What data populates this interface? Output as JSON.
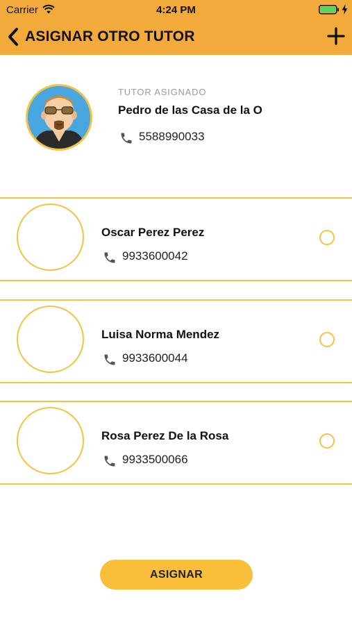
{
  "status_bar": {
    "carrier": "Carrier",
    "time": "4:24 PM",
    "battery_icon": "battery-charging-icon"
  },
  "nav": {
    "back_icon": "chevron-left-icon",
    "title": "ASIGNAR OTRO TUTOR",
    "add_icon": "plus-icon"
  },
  "assigned_tutor": {
    "label": "TUTOR ASIGNADO",
    "name": "Pedro de las Casa de la O",
    "phone": "5588990033"
  },
  "tutors": [
    {
      "name": "Oscar Perez Perez",
      "phone": "9933600042",
      "selected": false
    },
    {
      "name": "Luisa Norma Mendez",
      "phone": "9933600044",
      "selected": false
    },
    {
      "name": "Rosa Perez De la Rosa",
      "phone": "9933500066",
      "selected": false
    }
  ],
  "assign_button": {
    "label": "ASIGNAR"
  },
  "colors": {
    "header": "#f2aa3a",
    "accent_border": "#f5c242",
    "button": "#f9bf3b"
  }
}
